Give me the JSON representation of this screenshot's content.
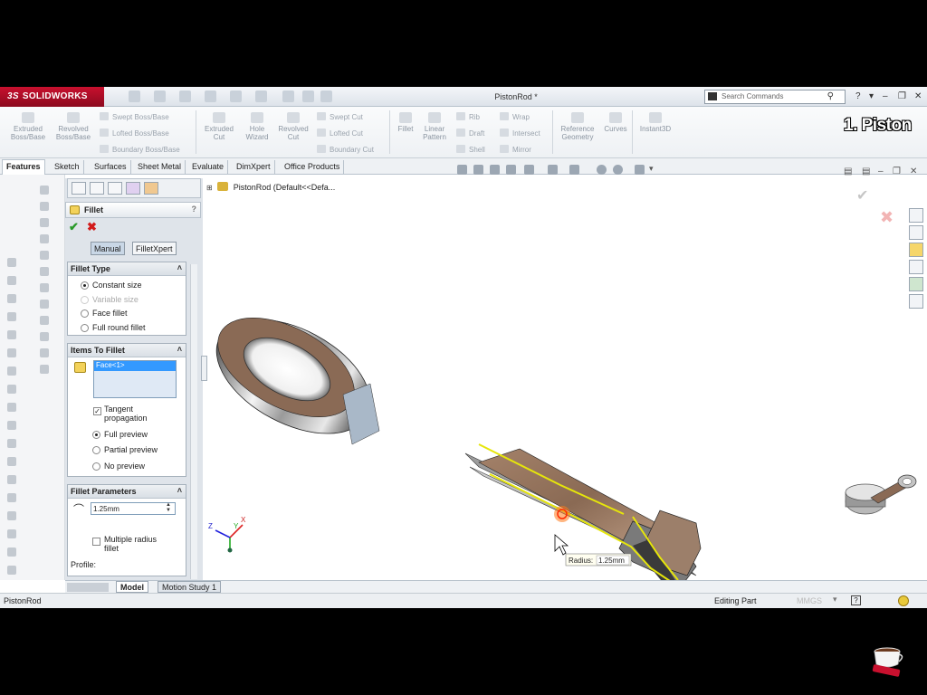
{
  "app": {
    "brand": "SOLIDWORKS",
    "brand_prefix": "3S",
    "document_title": "PistonRod *",
    "search_placeholder": "Search Commands",
    "video_label": "1. Piston"
  },
  "command_manager": {
    "big_buttons": [
      {
        "label": "Extruded\nBoss/Base",
        "icon": "extrude-boss-icon"
      },
      {
        "label": "Revolved\nBoss/Base",
        "icon": "revolve-boss-icon"
      },
      {
        "label": "Extruded\nCut",
        "icon": "extrude-cut-icon"
      },
      {
        "label": "Hole\nWizard",
        "icon": "hole-wizard-icon"
      },
      {
        "label": "Revolved\nCut",
        "icon": "revolve-cut-icon"
      },
      {
        "label": "Fillet",
        "icon": "fillet-icon"
      },
      {
        "label": "Linear\nPattern",
        "icon": "linear-pattern-icon"
      },
      {
        "label": "Reference\nGeometry",
        "icon": "reference-geometry-icon"
      },
      {
        "label": "Curves",
        "icon": "curves-icon"
      },
      {
        "label": "Instant3D",
        "icon": "instant3d-icon"
      }
    ],
    "small_buttons": {
      "swept_boss": "Swept Boss/Base",
      "lofted_boss": "Lofted Boss/Base",
      "boundary_boss": "Boundary Boss/Base",
      "swept_cut": "Swept Cut",
      "lofted_cut": "Lofted Cut",
      "boundary_cut": "Boundary Cut",
      "rib": "Rib",
      "draft": "Draft",
      "shell": "Shell",
      "wrap": "Wrap",
      "intersect": "Intersect",
      "mirror": "Mirror"
    }
  },
  "tabs": [
    "Features",
    "Sketch",
    "Surfaces",
    "Sheet Metal",
    "Evaluate",
    "DimXpert",
    "Office Products"
  ],
  "feature_tree": {
    "root": "PistonRod  (Default<<Defa..."
  },
  "property_manager": {
    "title": "Fillet",
    "help": "?",
    "mode_buttons": [
      "Manual",
      "FilletXpert"
    ],
    "fillet_type": {
      "header": "Fillet Type",
      "options": [
        {
          "label": "Constant size",
          "selected": true,
          "disabled": false
        },
        {
          "label": "Variable size",
          "selected": false,
          "disabled": true
        },
        {
          "label": "Face fillet",
          "selected": false,
          "disabled": false
        },
        {
          "label": "Full round fillet",
          "selected": false,
          "disabled": false
        }
      ]
    },
    "items_to_fillet": {
      "header": "Items To Fillet",
      "selected_item": "Face<1>",
      "tangent_propagation": "Tangent\npropagation",
      "tangent_checked": true,
      "preview_options": [
        {
          "label": "Full preview",
          "selected": true
        },
        {
          "label": "Partial preview",
          "selected": false
        },
        {
          "label": "No preview",
          "selected": false
        }
      ]
    },
    "fillet_parameters": {
      "header": "Fillet Parameters",
      "radius_value": "1.25mm",
      "multiple_radius": "Multiple radius\nfillet",
      "profile_label": "Profile:"
    }
  },
  "viewport": {
    "radius_callout_label": "Radius:",
    "radius_callout_value": "1.25mm",
    "triad": {
      "x": "X",
      "y": "Y",
      "z": "Z"
    }
  },
  "model_tabs": [
    "Model",
    "Motion Study 1"
  ],
  "status_bar": {
    "document": "PistonRod",
    "mode": "Editing Part",
    "units": "MMGS"
  },
  "colors": {
    "brand_red": "#c8102e",
    "selection_yellow": "#e6e60a",
    "ok_green": "#2a9a2a",
    "cancel_red": "#d21b1b"
  }
}
